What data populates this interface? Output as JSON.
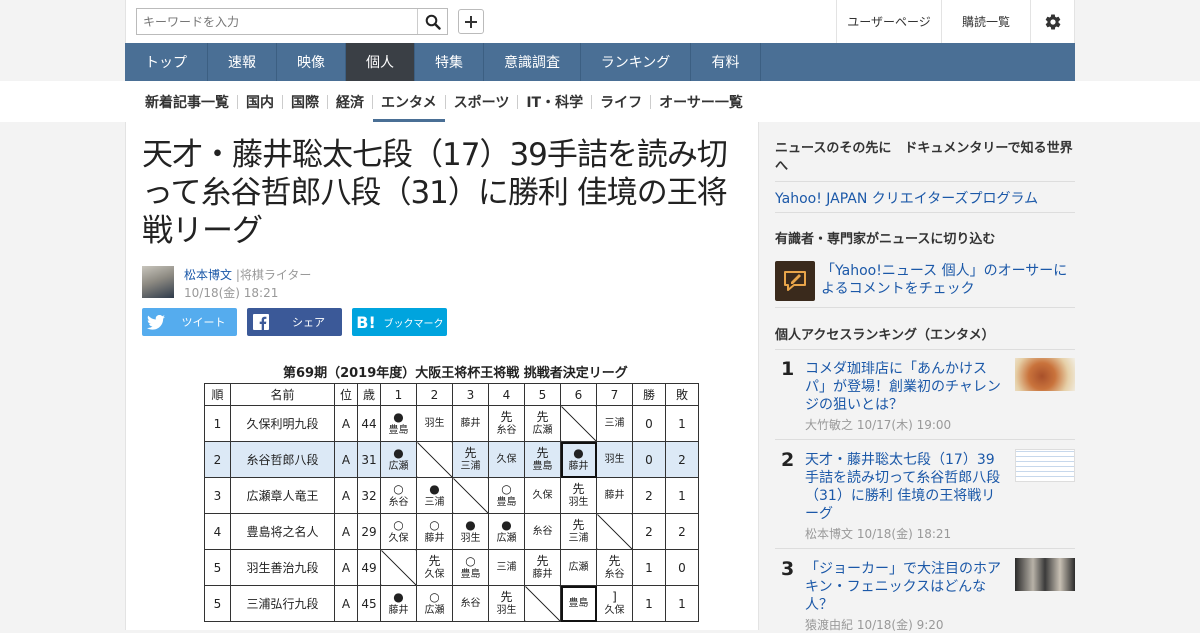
{
  "search": {
    "placeholder": "キーワードを入力"
  },
  "header": {
    "user_page": "ユーザーページ",
    "subscriptions": "購読一覧"
  },
  "main_nav": [
    "トップ",
    "速報",
    "映像",
    "個人",
    "特集",
    "意識調査",
    "ランキング",
    "有料"
  ],
  "main_nav_active": "個人",
  "sub_nav": [
    "新着記事一覧",
    "国内",
    "国際",
    "経済",
    "エンタメ",
    "スポーツ",
    "IT・科学",
    "ライフ",
    "オーサー一覧"
  ],
  "sub_nav_active": "エンタメ",
  "article": {
    "title": "天才・藤井聡太七段（17）39手詰を読み切って糸谷哲郎八段（31）に勝利 佳境の王将戦リーグ",
    "author": "松本博文",
    "role": "|将棋ライター",
    "date": "10/18(金) 18:21",
    "share": {
      "tweet": "ツイート",
      "facebook": "シェア",
      "bookmark": "ブックマーク"
    }
  },
  "league_table": {
    "title": "第69期（2019年度）大阪王将杯王将戦 挑戦者決定リーグ",
    "headers": [
      "順",
      "名前",
      "位",
      "歳",
      "1",
      "2",
      "3",
      "4",
      "5",
      "6",
      "7",
      "勝",
      "敗"
    ],
    "rows": [
      {
        "rank": "1",
        "name": "久保利明九段",
        "cls": "A",
        "age": "44",
        "cells": [
          [
            "●",
            "豊島"
          ],
          [
            "",
            "羽生"
          ],
          [
            "",
            "藤井"
          ],
          [
            "先",
            "糸谷"
          ],
          [
            "先",
            "広瀬"
          ],
          null,
          [
            "",
            "三浦"
          ]
        ],
        "wins": "0",
        "losses": "1"
      },
      {
        "rank": "2",
        "name": "糸谷哲郎八段",
        "cls": "A",
        "age": "31",
        "cells": [
          [
            "●",
            "広瀬"
          ],
          null,
          [
            "先",
            "三浦"
          ],
          [
            "",
            "久保"
          ],
          [
            "先",
            "豊島"
          ],
          [
            "●",
            "藤井"
          ],
          [
            "",
            "羽生"
          ]
        ],
        "wins": "0",
        "losses": "2"
      },
      {
        "rank": "3",
        "name": "広瀬章人竜王",
        "cls": "A",
        "age": "32",
        "cells": [
          [
            "○",
            "糸谷"
          ],
          [
            "●",
            "三浦"
          ],
          null,
          [
            "○",
            "豊島"
          ],
          [
            "",
            "久保"
          ],
          [
            "先",
            "羽生"
          ],
          [
            "",
            "藤井"
          ]
        ],
        "wins": "2",
        "losses": "1"
      },
      {
        "rank": "4",
        "name": "豊島将之名人",
        "cls": "A",
        "age": "29",
        "cells": [
          [
            "○",
            "久保"
          ],
          [
            "○",
            "藤井"
          ],
          [
            "●",
            "羽生"
          ],
          [
            "●",
            "広瀬"
          ],
          [
            "",
            "糸谷"
          ],
          [
            "先",
            "三浦"
          ],
          null
        ],
        "wins": "2",
        "losses": "2"
      },
      {
        "rank": "5",
        "name": "羽生善治九段",
        "cls": "A",
        "age": "49",
        "cells": [
          null,
          [
            "先",
            "久保"
          ],
          [
            "○",
            "豊島"
          ],
          [
            "",
            "三浦"
          ],
          [
            "先",
            "藤井"
          ],
          [
            "",
            "広瀬"
          ],
          [
            "先",
            "糸谷"
          ]
        ],
        "wins": "1",
        "losses": "0"
      },
      {
        "rank": "5",
        "name": "三浦弘行九段",
        "cls": "A",
        "age": "45",
        "cells": [
          [
            "●",
            "藤井"
          ],
          [
            "○",
            "広瀬"
          ],
          [
            "",
            "糸谷"
          ],
          [
            "先",
            "羽生"
          ],
          null,
          [
            "",
            "豊島"
          ],
          [
            "]",
            "久保"
          ]
        ],
        "wins": "1",
        "losses": "1"
      }
    ]
  },
  "sidebar": {
    "promo1": {
      "heading": "ニュースのその先に　ドキュメンタリーで知る世界へ",
      "link": "Yahoo! JAPAN クリエイターズプログラム"
    },
    "promo2": {
      "heading": "有識者・専門家がニュースに切り込む",
      "link": "「Yahoo!ニュース 個人」のオーサーによるコメントをチェック"
    },
    "ranking": {
      "heading": "個人アクセスランキング（エンタメ）",
      "items": [
        {
          "num": "1",
          "title": "コメダ珈琲店に「あんかけスパ」が登場！創業初のチャレンジの狙いとは？",
          "author": "大竹敏之",
          "date": "10/17(木) 19:00"
        },
        {
          "num": "2",
          "title": "天才・藤井聡太七段（17）39手詰を読み切って糸谷哲郎八段（31）に勝利 佳境の王将戦リーグ",
          "author": "松本博文",
          "date": "10/18(金) 18:21"
        },
        {
          "num": "3",
          "title": "「ジョーカー」で大注目のホアキン・フェニックスはどんな人？",
          "author": "猿渡由紀",
          "date": "10/18(金) 9:20"
        }
      ]
    }
  },
  "colors": {
    "nav": "#4a6f95",
    "nav_active": "#3a3f45",
    "link": "#1b58a8",
    "twitter": "#55acee",
    "facebook": "#3b5998",
    "hatena": "#00a4de",
    "highlight_row": "#dce9f6"
  }
}
